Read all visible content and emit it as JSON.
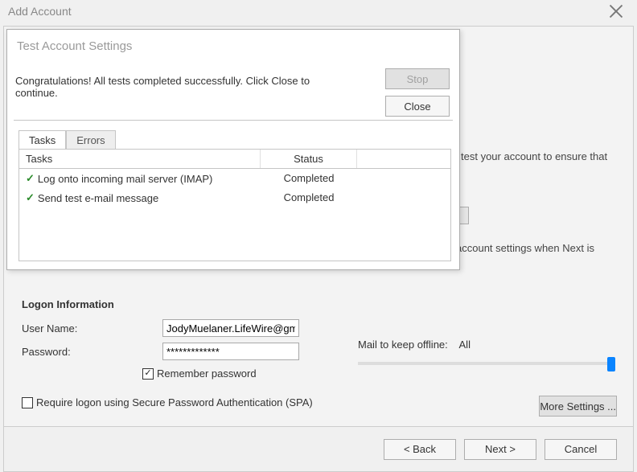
{
  "outer": {
    "title": "Add Account",
    "partial_text_1": "test your account to ensure that",
    "partial_text_2": "account settings when Next is"
  },
  "logon": {
    "header": "Logon Information",
    "username_label": "User Name:",
    "username_value": "JodyMuelaner.LifeWire@gma",
    "password_label": "Password:",
    "password_value": "*************",
    "remember_label": "Remember password",
    "spa_label": "Require logon using Secure Password Authentication (SPA)"
  },
  "offline": {
    "label": "Mail to keep offline:",
    "value": "All"
  },
  "buttons": {
    "more_settings": "More Settings ...",
    "back": "< Back",
    "next": "Next >",
    "cancel": "Cancel"
  },
  "modal": {
    "title": "Test Account Settings",
    "message": "Congratulations! All tests completed successfully. Click Close to continue.",
    "stop": "Stop",
    "close": "Close",
    "tab_tasks": "Tasks",
    "tab_errors": "Errors",
    "col_tasks": "Tasks",
    "col_status": "Status",
    "rows": [
      {
        "task": "Log onto incoming mail server (IMAP)",
        "status": "Completed"
      },
      {
        "task": "Send test e-mail message",
        "status": "Completed"
      }
    ]
  }
}
